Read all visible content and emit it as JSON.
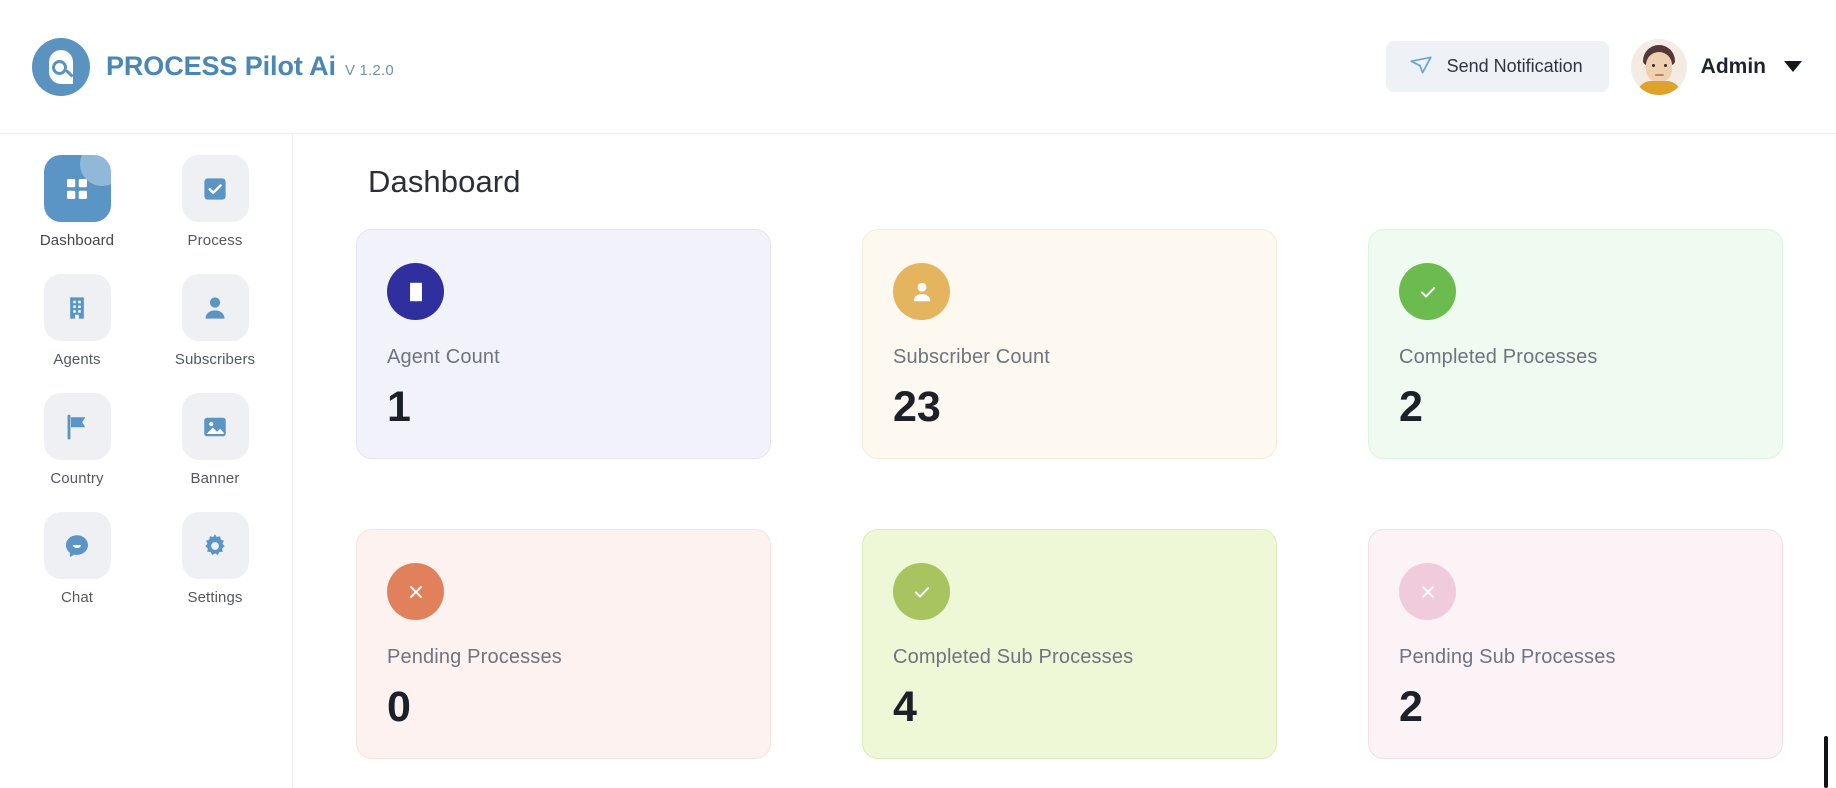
{
  "header": {
    "brand_name": "PROCESS Pilot Ai",
    "version": "V 1.2.0",
    "send_notification_label": "Send Notification",
    "user_name": "Admin"
  },
  "sidebar": {
    "items": [
      {
        "label": "Dashboard",
        "icon": "grid-icon",
        "active": true
      },
      {
        "label": "Process",
        "icon": "checkbox-icon",
        "active": false
      },
      {
        "label": "Agents",
        "icon": "building-icon",
        "active": false
      },
      {
        "label": "Subscribers",
        "icon": "person-icon",
        "active": false
      },
      {
        "label": "Country",
        "icon": "flag-icon",
        "active": false
      },
      {
        "label": "Banner",
        "icon": "image-icon",
        "active": false
      },
      {
        "label": "Chat",
        "icon": "chat-bubble-icon",
        "active": false
      },
      {
        "label": "Settings",
        "icon": "gear-icon",
        "active": false
      }
    ]
  },
  "main": {
    "page_title": "Dashboard",
    "cards": [
      {
        "label": "Agent Count",
        "value": "1",
        "icon": "building-icon",
        "icon_bg": "#2f2f9e",
        "card_bg": "#f2f2fb",
        "card_border": "#e3e3f4"
      },
      {
        "label": "Subscriber Count",
        "value": "23",
        "icon": "person-icon",
        "icon_bg": "#e5b45f",
        "card_bg": "#fdf9f0",
        "card_border": "#f5ecd9"
      },
      {
        "label": "Completed Processes",
        "value": "2",
        "icon": "check-icon",
        "icon_bg": "#6cbb4f",
        "card_bg": "#effaf0",
        "card_border": "#def2e0"
      },
      {
        "label": "Pending Processes",
        "value": "0",
        "icon": "close-icon",
        "icon_bg": "#e0815c",
        "card_bg": "#fdf2f0",
        "card_border": "#f7e3de"
      },
      {
        "label": "Completed Sub Processes",
        "value": "4",
        "icon": "check-icon",
        "icon_bg": "#a7c460",
        "card_bg": "#eef8d6",
        "card_border": "#dcecbb"
      },
      {
        "label": "Pending Sub Processes",
        "value": "2",
        "icon": "close-icon",
        "icon_bg": "#f0cbdb",
        "card_bg": "#fcf3f6",
        "card_border": "#f4dde6"
      }
    ]
  },
  "colors": {
    "brand_blue": "#4a87b4",
    "sidebar_active": "#5b95c6",
    "icon_blue": "#5b95c6"
  }
}
